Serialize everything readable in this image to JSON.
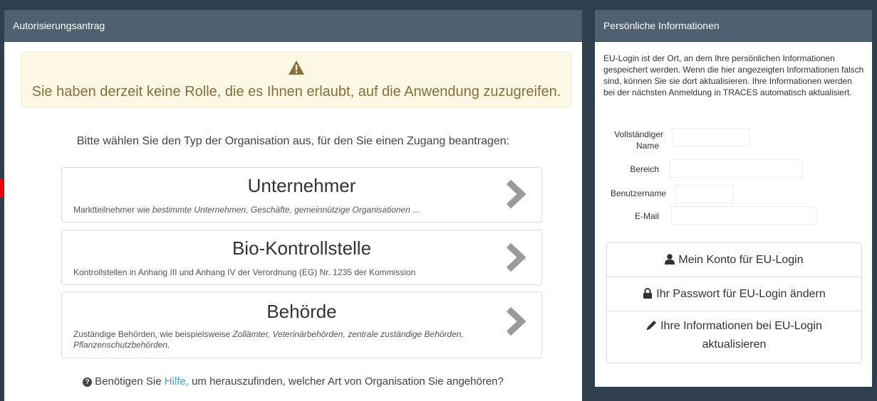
{
  "left_panel": {
    "title": "Autorisierungsantrag",
    "alert_message": "Sie haben derzeit keine Rolle, die es Ihnen erlaubt, auf die Anwendung zuzugreifen.",
    "choose_prompt": "Bitte wählen Sie den Typ der Organisation aus, für den Sie einen Zugang beantragen:",
    "org_types": [
      {
        "title": "Unternehmer",
        "desc_plain": "Marktteilnehmer wie ",
        "desc_italic": "bestimmte Unternehmen, Geschäfte, gemeinnützige Organisationen ...",
        "desc_after": ""
      },
      {
        "title": "Bio-Kontrollstelle",
        "desc_plain": "Kontrollstellen in Anhang III und Anhang IV der Verordnung (EG) Nr. 1235 der Kommission",
        "desc_italic": "",
        "desc_after": ""
      },
      {
        "title": "Behörde",
        "desc_plain": "Zuständige Behörden, wie beispielsweise ",
        "desc_italic": "Zollämter, Veterinärbehörden, zentrale zuständige Behörden, Pflanzenschutzbehörden,",
        "desc_after": ""
      }
    ],
    "help": {
      "before": "Benötigen Sie ",
      "link": "Hilfe,",
      "after": " um herauszufinden, welcher Art von Organisation Sie angehören?"
    }
  },
  "right_panel": {
    "title": "Persönliche Informationen",
    "info_text": "EU-Login ist der Ort, an dem Ihre persönlichen Informationen gespeichert werden. Wenn die hier angezeigten Informationen falsch sind, können Sie sie dort aktualisieren. Ihre Informationen werden bei der nächsten Anmeldung in TRACES automatisch aktualisiert.",
    "fields": {
      "full_name_label_1": "Vollständiger",
      "full_name_label_2": "Name",
      "area_label": "Bereich",
      "username_label": "Benutzername",
      "email_label": "E-Mail",
      "full_name_value": "",
      "area_value": "",
      "username_value": "",
      "email_value": ""
    },
    "buttons": {
      "account": "Mein Konto für EU-Login",
      "password": "Ihr Passwort für EU-Login ändern",
      "update_1": "Ihre Informationen bei EU-Login",
      "update_2": "aktualisieren"
    }
  },
  "icons": {
    "alert": "warning-triangle-icon",
    "chevron": "chevron-right-icon",
    "help": "question-circle-icon",
    "account": "user-icon",
    "password": "lock-icon",
    "update": "pencil-icon",
    "annotation": "red-arrow"
  },
  "colors": {
    "header_bg": "#4e6170",
    "alert_bg": "#fcf8e3",
    "alert_text": "#8a6d3b",
    "link": "#4a9fd8",
    "arrow": "#e8000a"
  }
}
